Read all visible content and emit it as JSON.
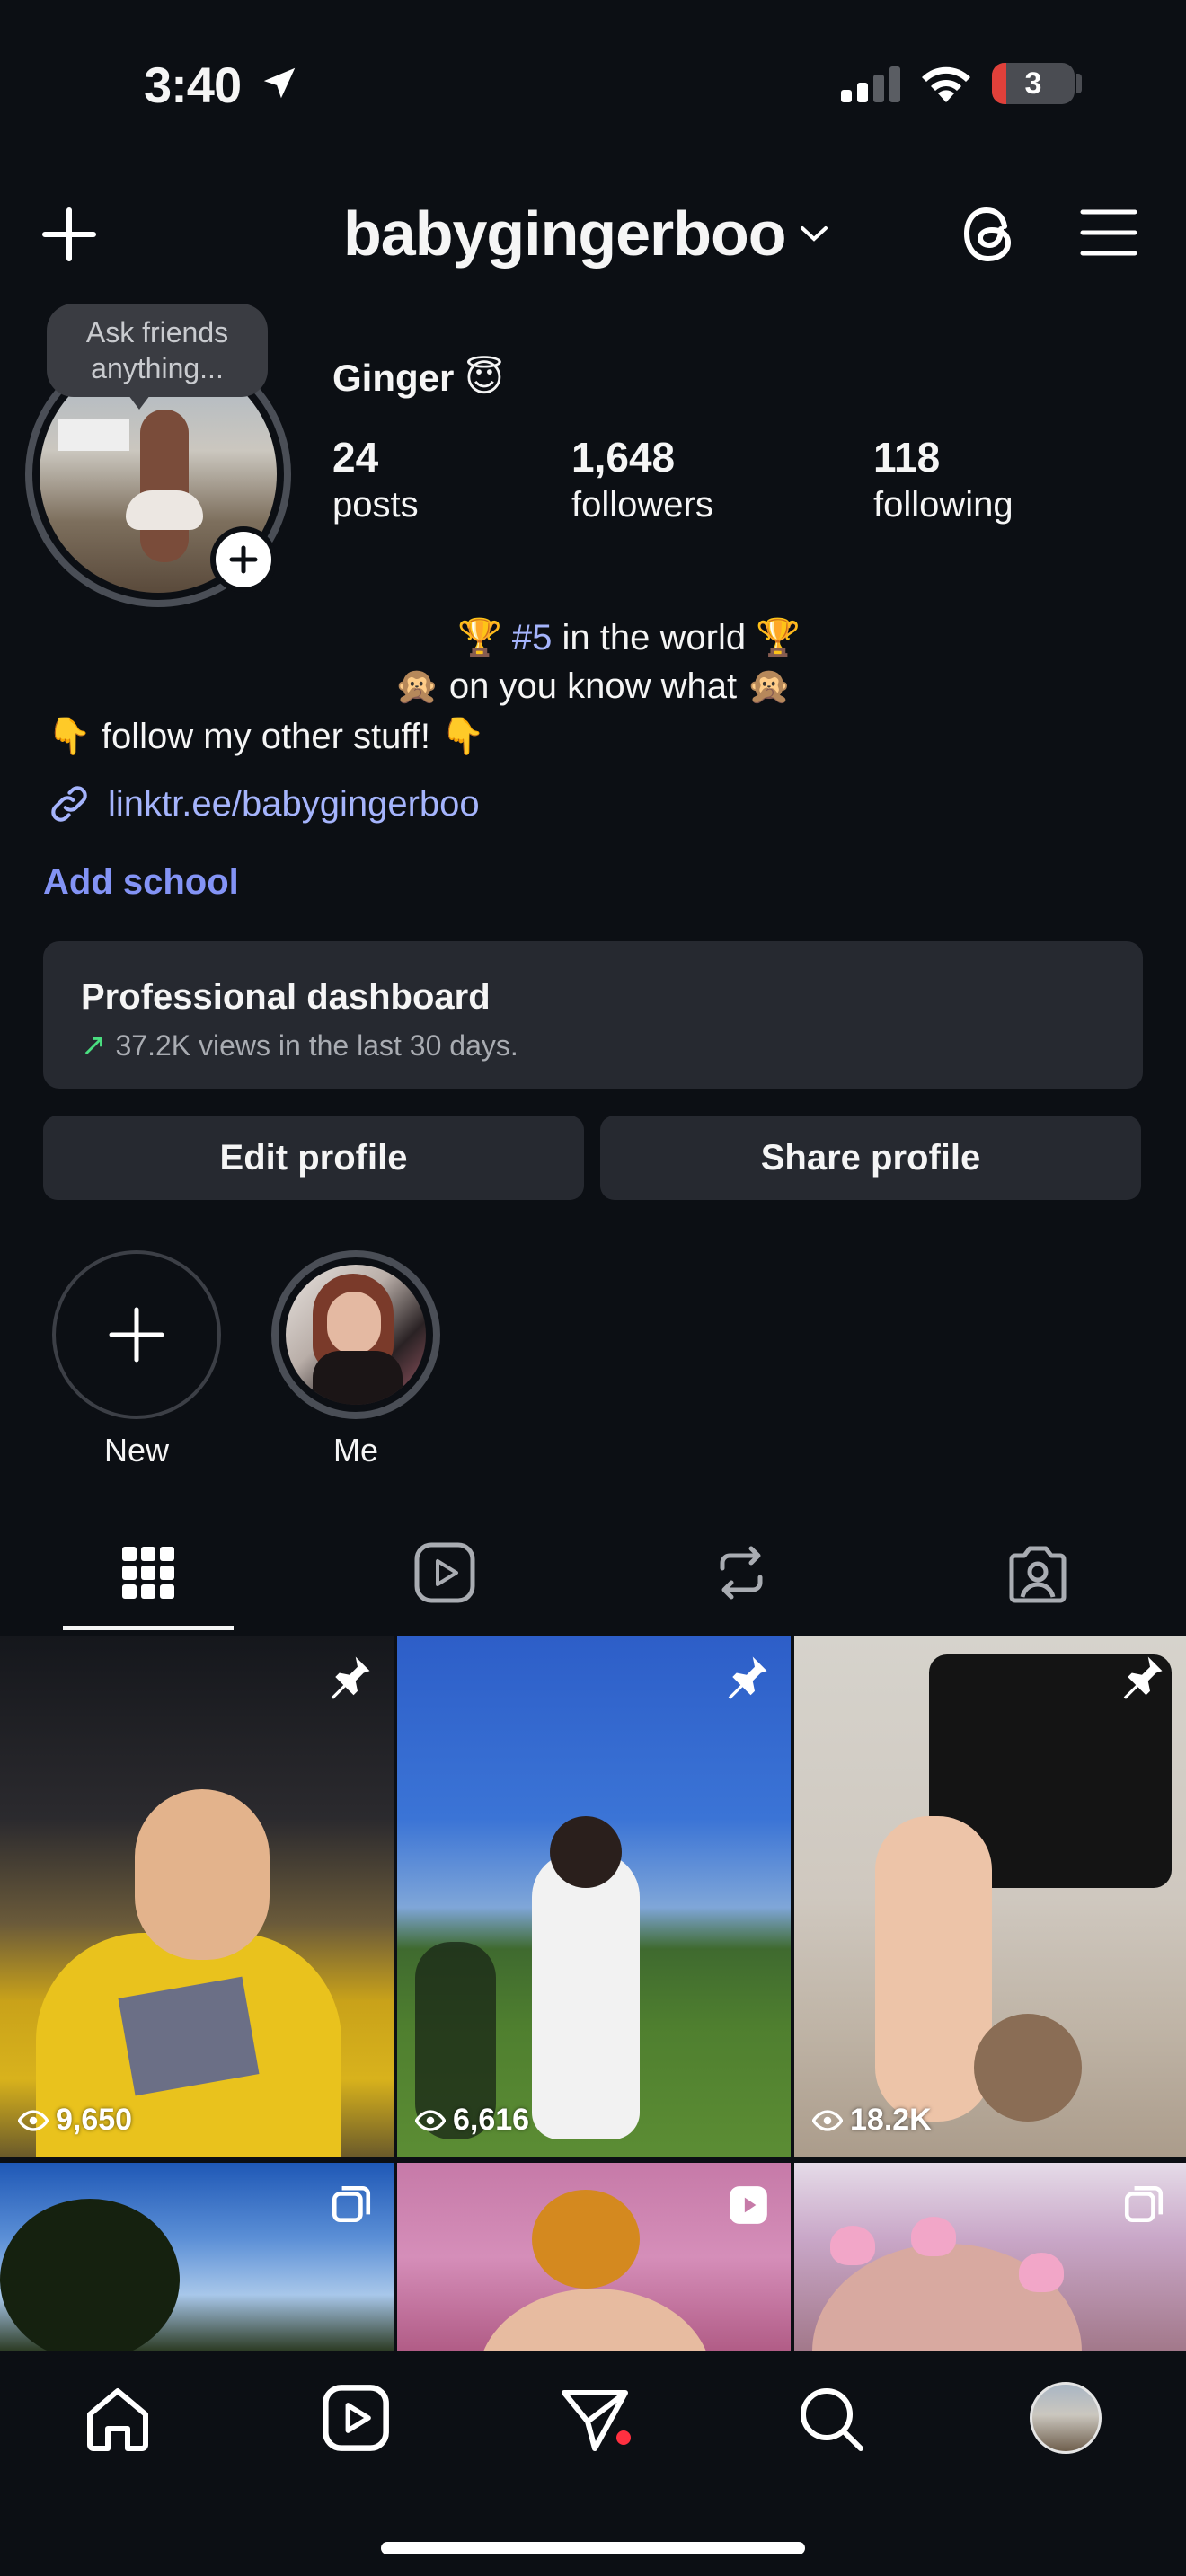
{
  "status_bar": {
    "time": "3:40",
    "battery": "3"
  },
  "header": {
    "username": "babygingerboo"
  },
  "profile": {
    "note_bubble": [
      "Ask friends",
      "anything..."
    ],
    "display_name": "Ginger 😇",
    "stats": [
      {
        "value": "24",
        "label": "posts"
      },
      {
        "value": "1,648",
        "label": "followers"
      },
      {
        "value": "118",
        "label": "following"
      }
    ],
    "bio": {
      "line1_prefix": "🏆 ",
      "line1_hashtag": "#5",
      "line1_suffix": " in the world 🏆",
      "line2": "🙊 on you know what 🙊",
      "line3": "👇 follow my other stuff! 👇"
    },
    "link": "linktr.ee/babygingerboo",
    "add_school": "Add school"
  },
  "dashboard": {
    "title": "Professional dashboard",
    "subtitle": "37.2K views in the last 30 days."
  },
  "buttons": {
    "edit": "Edit profile",
    "share": "Share profile"
  },
  "highlights": [
    {
      "label": "New"
    },
    {
      "label": "Me"
    }
  ],
  "posts": [
    {
      "views": "9,650",
      "pinned": true
    },
    {
      "views": "6,616",
      "pinned": true
    },
    {
      "views": "18.2K",
      "pinned": true
    },
    {
      "type": "carousel"
    },
    {
      "type": "reel"
    },
    {
      "type": "carousel"
    }
  ],
  "colors": {
    "background": "#0c0f14",
    "accent_link": "#a5b4fc",
    "card": "#262930",
    "notification_dot": "#ff3040"
  }
}
